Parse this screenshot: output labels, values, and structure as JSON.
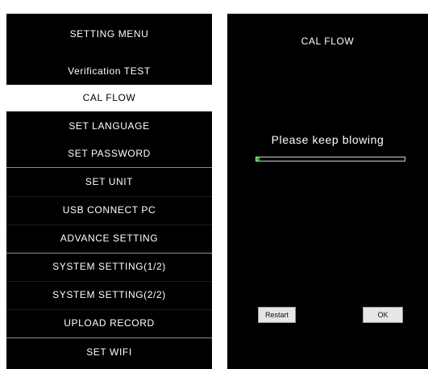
{
  "menu": {
    "title": "SETTING MENU",
    "items": [
      {
        "label": "Verification TEST"
      },
      {
        "label": "CAL FLOW",
        "selected": true
      },
      {
        "label": "SET LANGUAGE"
      },
      {
        "label": "SET PASSWORD"
      },
      {
        "label": "SET UNIT"
      },
      {
        "label": "USB CONNECT PC"
      },
      {
        "label": "ADVANCE SETTING"
      },
      {
        "label": "SYSTEM SETTING(1/2)"
      },
      {
        "label": "SYSTEM SETTING(2/2)"
      },
      {
        "label": "UPLOAD RECORD"
      },
      {
        "label": "SET WIFI"
      }
    ]
  },
  "calibration": {
    "title": "CAL FLOW",
    "status": "Please keep blowing",
    "progress": 0.02,
    "progress_color": "#22c422",
    "restart_label": "Restart",
    "ok_label": "OK"
  }
}
